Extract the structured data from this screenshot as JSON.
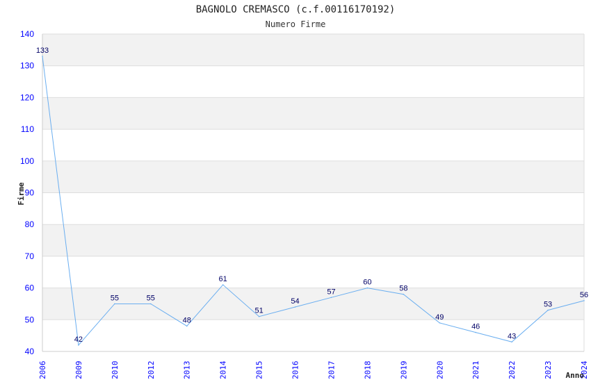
{
  "chart_data": {
    "type": "line",
    "title": "BAGNOLO CREMASCO (c.f.00116170192)",
    "subtitle": "Numero Firme",
    "xlabel": "Anno",
    "ylabel": "Firme",
    "ylim": [
      40,
      140
    ],
    "yticks": [
      40,
      50,
      60,
      70,
      80,
      90,
      100,
      110,
      120,
      130,
      140
    ],
    "categories": [
      "2006",
      "2009",
      "2010",
      "2012",
      "2013",
      "2014",
      "2015",
      "2016",
      "2017",
      "2018",
      "2019",
      "2020",
      "2021",
      "2022",
      "2023",
      "2024"
    ],
    "series": [
      {
        "values": [
          133,
          42,
          55,
          55,
          48,
          61,
          51,
          54,
          57,
          60,
          58,
          49,
          46,
          43,
          53,
          56
        ]
      }
    ],
    "grid": true,
    "colors": {
      "line": "#6aaef0",
      "tick_labels": "#0000ff",
      "data_labels": "#000066",
      "band": "#f2f2f2",
      "gridline": "#dddddd"
    }
  }
}
